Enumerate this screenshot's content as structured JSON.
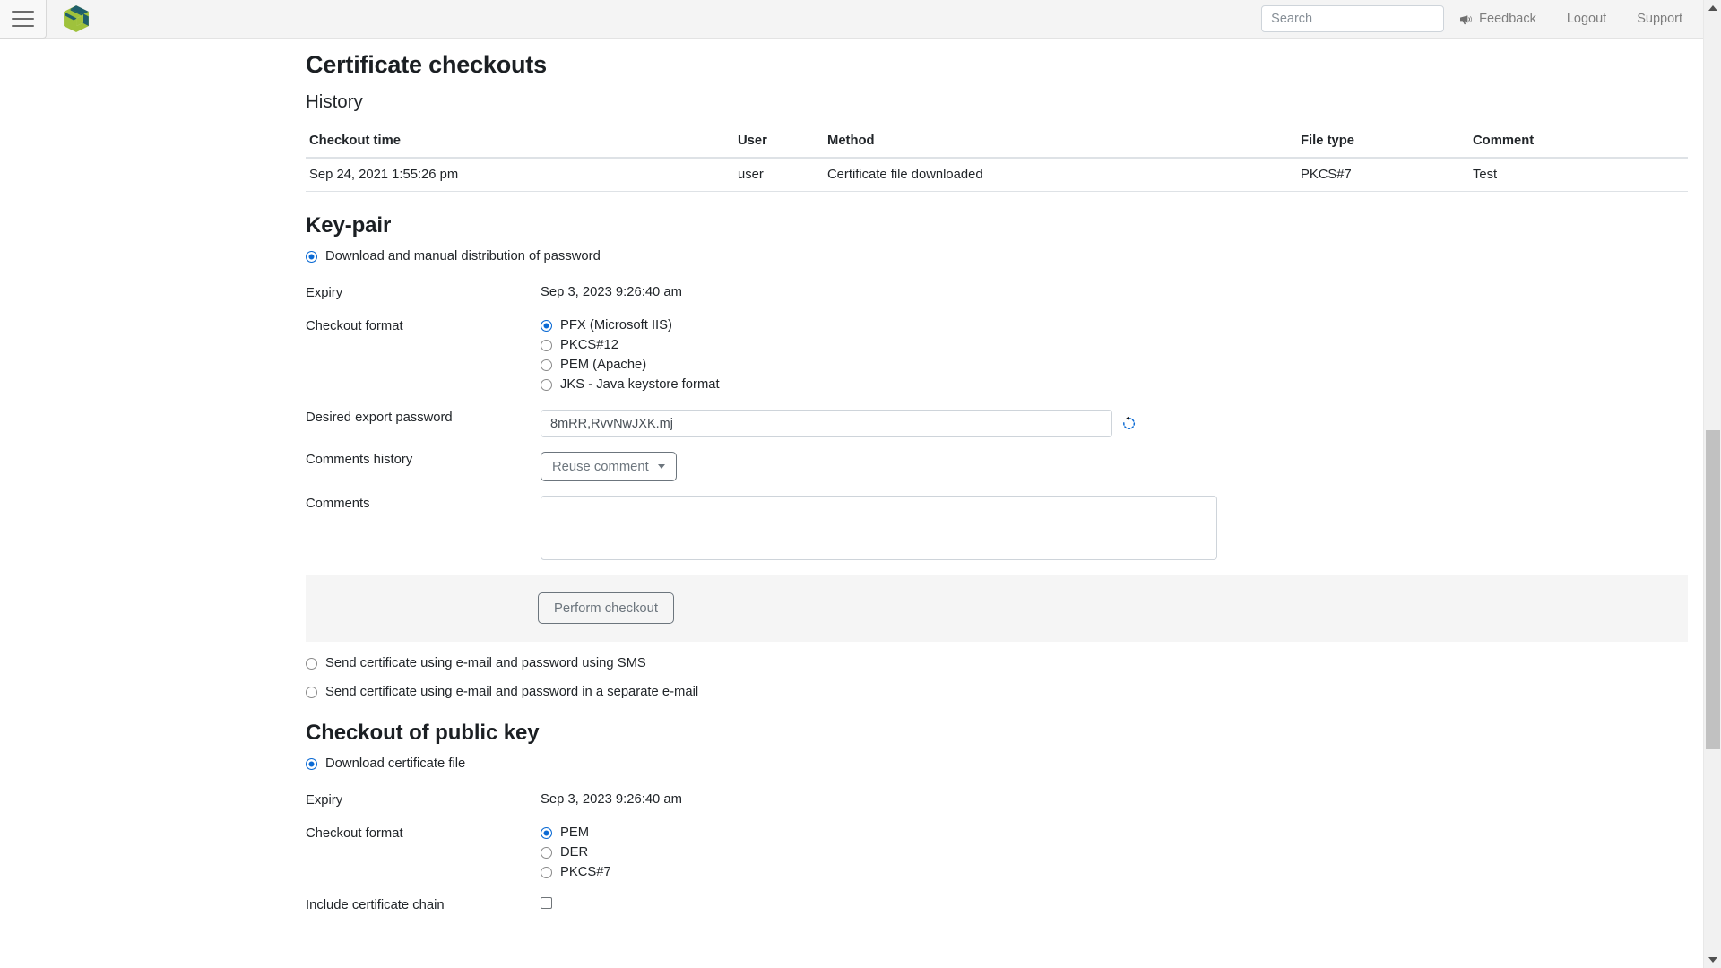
{
  "header": {
    "menu_icon": "hamburger-menu-icon",
    "logo_icon": "cube-logo-icon",
    "search": {
      "value": "",
      "placeholder": "Search"
    },
    "links": [
      {
        "label": "Feedback",
        "icon": "megaphone-icon"
      },
      {
        "label": "Logout",
        "icon": null
      },
      {
        "label": "Support",
        "icon": null
      }
    ]
  },
  "page": {
    "title": "Certificate checkouts",
    "history_heading": "History"
  },
  "history_table": {
    "columns": [
      "Checkout time",
      "User",
      "Method",
      "File type",
      "Comment"
    ],
    "rows": [
      {
        "checkout_time": "Sep 24, 2021 1:55:26 pm",
        "user": "user",
        "method": "Certificate file downloaded",
        "file_type": "PKCS#7",
        "comment": "Test"
      }
    ]
  },
  "keypair": {
    "heading": "Key-pair",
    "delivery_options": [
      {
        "label": "Download and manual distribution of password",
        "selected": true
      },
      {
        "label": "Send certificate using e-mail and password using SMS",
        "selected": false
      },
      {
        "label": "Send certificate using e-mail and password in a separate e-mail",
        "selected": false
      }
    ],
    "expiry_label": "Expiry",
    "expiry_value": "Sep 3, 2023 9:26:40 am",
    "format_label": "Checkout format",
    "formats": [
      {
        "label": "PFX (Microsoft IIS)",
        "selected": true
      },
      {
        "label": "PKCS#12",
        "selected": false
      },
      {
        "label": "PEM (Apache)",
        "selected": false
      },
      {
        "label": "JKS - Java keystore format",
        "selected": false
      }
    ],
    "password_label": "Desired export password",
    "password_value": "8mRR,RvvNwJXK.mj",
    "password_placeholder": "",
    "regenerate_icon": "refresh-rotate-icon",
    "comments_history_label": "Comments history",
    "reuse_comment_label": "Reuse comment",
    "comments_label": "Comments",
    "comments_value": "",
    "comments_placeholder": "",
    "perform_checkout_label": "Perform checkout"
  },
  "publickey": {
    "heading": "Checkout of public key",
    "download_option": {
      "label": "Download certificate file",
      "selected": true
    },
    "expiry_label": "Expiry",
    "expiry_value": "Sep 3, 2023 9:26:40 am",
    "format_label": "Checkout format",
    "formats": [
      {
        "label": "PEM",
        "selected": true
      },
      {
        "label": "DER",
        "selected": false
      },
      {
        "label": "PKCS#7",
        "selected": false
      }
    ],
    "include_chain_label": "Include certificate chain",
    "include_chain_checked": false
  },
  "colors": {
    "accent_blue": "#0b6ad4",
    "logo_green": "#9fc23c",
    "logo_teal": "#1f5f6b",
    "panel_gray": "#f5f5f5",
    "topbar_gray": "#f4f4f4",
    "muted_text": "#6c757d"
  },
  "scrollbar": {
    "up_arrow": "caret-up-icon",
    "down_arrow": "caret-down-icon"
  }
}
